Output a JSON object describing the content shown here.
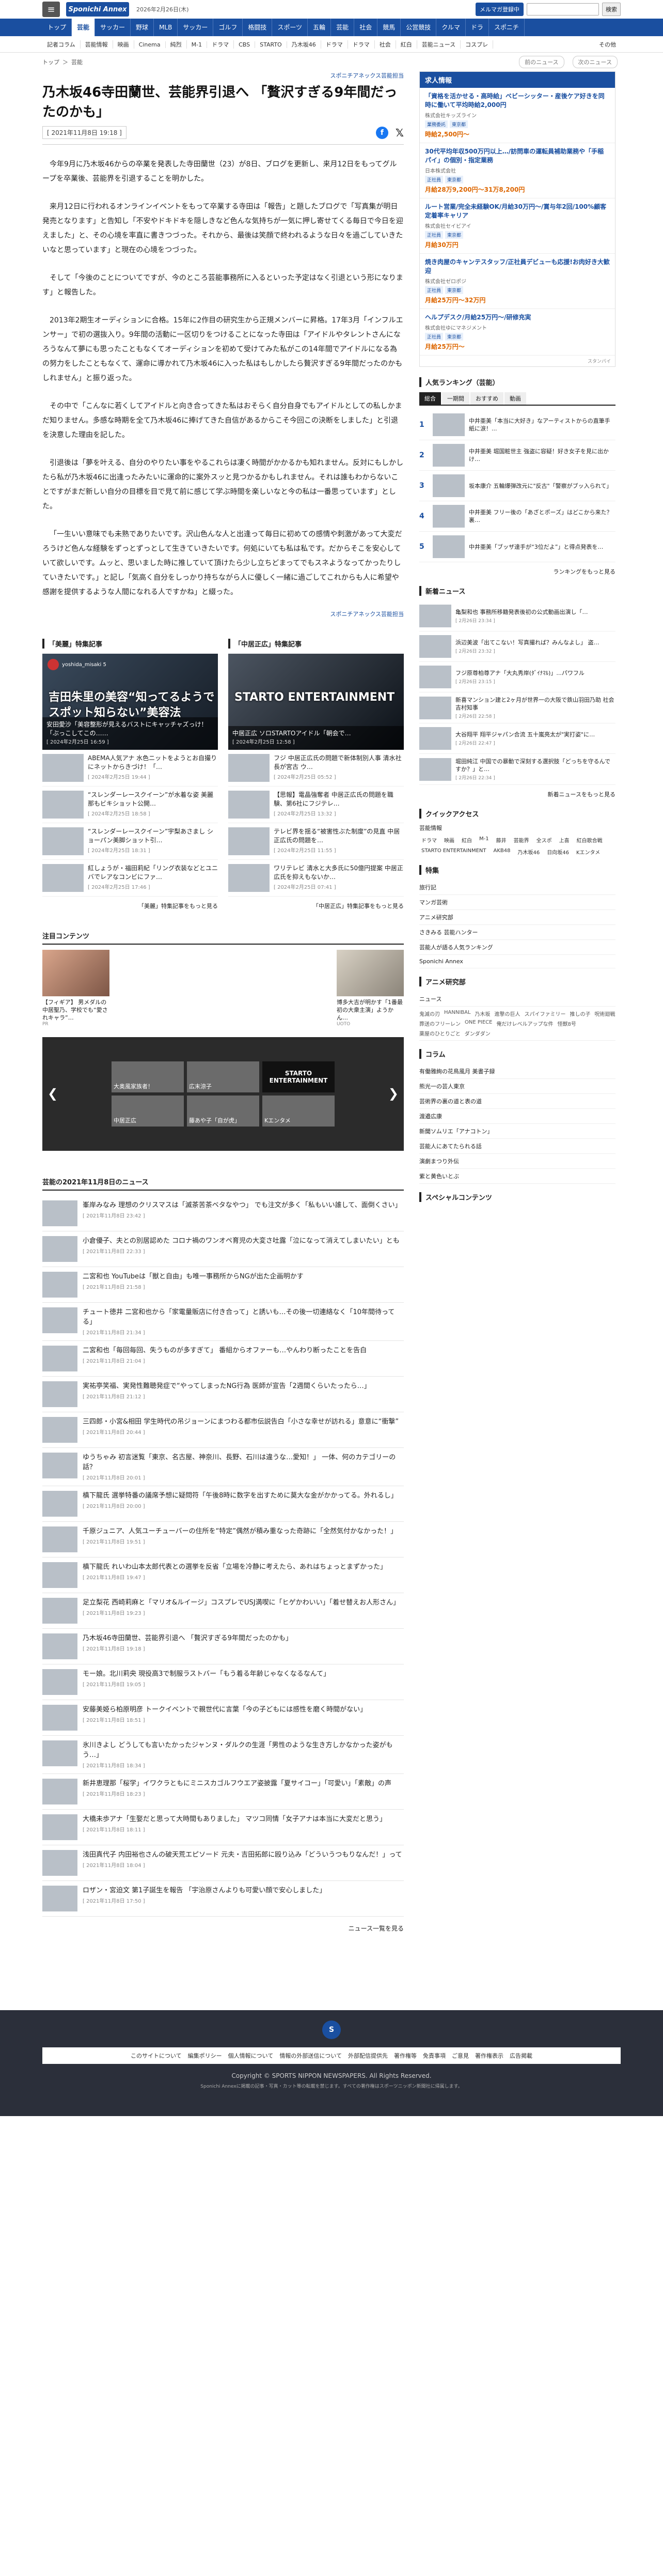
{
  "header": {
    "date": "2026年2月26日(木)",
    "subscribe": "メルマガ登録中",
    "search_btn": "検索",
    "logo": "Sponichi Annex"
  },
  "nav": [
    "トップ",
    "芸能",
    "サッカー",
    "野球",
    "MLB",
    "サッカー",
    "ゴルフ",
    "格闘技",
    "スポーツ",
    "五輪",
    "芸能",
    "社会",
    "競馬",
    "公営競技",
    "クルマ",
    "ドラ",
    "スポニチ"
  ],
  "subnav": [
    "記者コラム",
    "芸能情報",
    "映画",
    "Cinema",
    "純烈",
    "M-1",
    "ドラマ",
    "CBS",
    "STARTO",
    "乃木坂46",
    "ドラマ",
    "ドラマ",
    "社会",
    "紅白",
    "芸能ニュース",
    "コスプレ"
  ],
  "subnav_more": "その他",
  "crumbs": [
    "トップ",
    "＞",
    "芸能"
  ],
  "pager": {
    "prev": "前のニュース",
    "next": "次のニュース"
  },
  "article": {
    "credit": "スポニチアネックス芸能担当",
    "title": "乃木坂46寺田蘭世、芸能界引退へ 「贅沢すぎる9年間だったのかも」",
    "date": "[ 2021年11月8日 19:18 ]",
    "paragraphs": [
      "今年9月に乃木坂46からの卒業を発表した寺田蘭世（23）が8日、ブログを更新し、来月12日をもってグループを卒業後、芸能界を引退することを明かした。",
      "来月12日に行われるオンラインイベントをもって卒業する寺田は「報告」と題したブログで「写真集が明日発売となります」と告知し「不安やドキドキを隠しきなど色んな気持ちが一気に押し寄せてくる毎日で今日を迎えました」と、その心境を率直に書きつづった。それから、最後は笑顔で終われるような日々を過ごしていきたいなと思っています」と現在の心境をつづった。",
      "そして「今後のことについてですが、今のところ芸能事務所に入るといった予定はなく引退という形になります」と報告した。",
      "2013年2期生オーディションに合格。15年に2作目の研究生から正規メンバーに昇格。17年3月「インフルエンサー」で初の選抜入り。9年間の活動に一区切りをつけることになった寺田は「アイドルやタレントさんになろうなんて夢にも思ったこともなくてオーディションを初めて受けてみた私がこの14年間でアイドルになる為の努力をしたこともなくて、運命に導かれて乃木坂46に入った私はもしかしたら贅沢すぎる9年間だったのかもしれません」と振り返った。",
      "その中で「こんなに若くしてアイドルと向き合ってきた私はおそらく自分自身でもアイドルとしての私しかまだ知りません。多感な時期を全て乃木坂46に捧げてきた自信があるからこそ今回この決断をしました」と引退を決意した理由を記した。",
      "引退後は「夢を叶える、自分のやりたい事をやるこれらは凄く時間がかかるかも知れません。反対にもしかしたら私が乃木坂46に出逢ったみたいに運命的に案外スッと見つかるかもしれません。それは誰もわからないことですがまだ新しい自分の目標を目で見て前に感じて学ぶ時間を楽しいなと今の私は一番思っています」とした。",
      "「一生いい意味でも未熟でありたいです。沢山色んな人と出逢って毎日に初めての感情や刺激があって大変だろうけど色んな経験をずっとずっとして生きていきたいです。何処にいても私は私です。だからそこを安心していて欲しいです。ムッと、思いました時に推していて頂けたら少し立ちどまってでもスネようなってかったりしていきたいです。」と記し「気高く自分をしっかり持ちながら人に優しく一緒に過ごしてこれからも人に希望や感謝を提供するような人間になれる人ですかね」と綴った。"
    ],
    "credit2": "スポニチアネックス芸能担当"
  },
  "features": [
    {
      "head": "「美麗」特集記事",
      "channel": "yoshida_misaki 5",
      "hero": "吉田朱里の美容“知ってるようでスポット知らない”美容法",
      "cap": "安田愛沙「美容整形が見えるバストにキャッチャズっけ！「ぶっこしてこの……",
      "capdate": "[ 2024年2月25日 16:59 ]",
      "items": [
        {
          "t": "ABEMA人気アナ 水色ニットをようとお自撮りにネットからきづけ！「…",
          "d": "[ 2024年2月25日 19:44 ]"
        },
        {
          "t": "“スレンダーレースクイーン”が水着な姿 美麗那もビキショット公開…",
          "d": "[ 2024年2月25日 18:58 ]"
        },
        {
          "t": "“スレンダーレースクイーン”宇梨あさまし ショーパン美脚ショット引…",
          "d": "[ 2024年2月25日 18:31 ]"
        },
        {
          "t": "紅しょうが・福田莉紀「リング衣装などとユニバでレアなコンビにファ…",
          "d": "[ 2024年2月25日 17:46 ]"
        }
      ],
      "more": "「美麗」特集記事をもっと見る"
    },
    {
      "head": "「中居正広」特集記事",
      "channel": "",
      "hero": "STARTO ENTERTAINMENT",
      "cap": "中居正広 ソロSTARTOアイドル「朝会で…",
      "capdate": "[ 2024年2月25日 12:58 ]",
      "items": [
        {
          "t": "フジ 中居正広氏の問題で新体制別人事 清水社長が宮古 ウ…",
          "d": "[ 2024年2月25日 05:52 ]"
        },
        {
          "t": "【思報】電晶強奪者 中居正広氏の問題を職験、第6社にフジテレ…",
          "d": "[ 2024年2月25日 13:32 ]"
        },
        {
          "t": "テレビ界を揺る“被害性ぶた制度”の見直 中居正広氏の問題を…",
          "d": "[ 2024年2月25日 11:55 ]"
        },
        {
          "t": "ワリテレビ 清水と大多氏に50億円提案 中居正広氏を抑えもないか…",
          "d": "[ 2024年2月25日 07:41 ]"
        }
      ],
      "more": "「中居正広」特集記事をもっと見る"
    }
  ],
  "chu": {
    "head": "注目コンテンツ",
    "items": [
      {
        "t": "【フィギア】 男メダルの中居聖乃、学校でも“愛されキャラ”…",
        "src": "PR"
      },
      {
        "t": "博多大吉が明かす「1番最初の大衆主演」ようかん…",
        "src": "UOTO"
      }
    ]
  },
  "carousel": {
    "tiles": [
      "大奥風家族者！",
      "広末涼子",
      "STARTO ENTERTAINMENT",
      "中居正広",
      "藤あや子「自が虎」",
      "Kエンタメ"
    ]
  },
  "newslist": {
    "head": "芸能の2021年11月8日のニュース",
    "items": [
      {
        "t": "峯岸みなみ 理想のクリスマスは「滅茶苦茶ベタなやつ」 でも注文が多く「私もいい誰して、面倒くさい」",
        "d": "[ 2021年11月8日 23:42 ]"
      },
      {
        "t": "小倉優子、夫との別居認めた コロナ禍のワンオペ育児の大変さ吐露「泣になって消えてしまいたい」とも",
        "d": "[ 2021年11月8日 22:33 ]"
      },
      {
        "t": "二宮和也 YouTubeは「獣と自由」も唯一事務所からNGが出た企画明かす",
        "d": "[ 2021年11月8日 21:58 ]"
      },
      {
        "t": "チュート徳井 二宮和也から「家電量販店に付き合って」と誘いも…その後一切連絡なく「10年間待ってる」",
        "d": "[ 2021年11月8日 21:34 ]"
      },
      {
        "t": "二宮和也「毎回毎回、失うものが多すぎて」 番組からオファーも…やんわり断ったことを告白",
        "d": "[ 2021年11月8日 21:04 ]"
      },
      {
        "t": "実祐亭笑福、実発性難聴発症で“やってしまったNG行為 医師が宣告「2週間くらいたったら…」",
        "d": "[ 2021年11月8日 21:12 ]"
      },
      {
        "t": "三四郎・小宮&相田 学生時代の吊ジョーンにまつわる都市伝説告白「小さな幸せが訪れる」意意に“衝撃”",
        "d": "[ 2021年11月8日 20:44 ]"
      },
      {
        "t": "ゆうちゃみ 初言迷覧「東京、名古屋、神奈川、長野、石川は違うな…愛知！」 一体、何のカテゴリーの話？",
        "d": "[ 2021年11月8日 20:01 ]"
      },
      {
        "t": "槙下龍氏 選挙特番の議席予想に疑問符「午後8時に数字を出すために莫大な金がかかってる。外れるし」",
        "d": "[ 2021年11月8日 20:00 ]"
      },
      {
        "t": "千原ジュニア、人気ユーチューバーの住所を“特定”偶然が積み重なった奇跡に「全然気付かなかった！」",
        "d": "[ 2021年11月8日 19:51 ]"
      },
      {
        "t": "槙下龍氏 れいわ山本太郎代表との選挙を反省「立場を冷静に考えたら、あれはちょっとまずかった」",
        "d": "[ 2021年11月8日 19:47 ]"
      },
      {
        "t": "足立梨花 西崎莉麻と「マリオ&ルイージ」コスプレでUSJ満喫に「ヒゲかわいい」「着せ替えお人形さん」",
        "d": "[ 2021年11月8日 19:23 ]"
      },
      {
        "t": "乃木坂46寺田蘭世、芸能界引退へ 「贅沢すぎる9年間だったのかも」",
        "d": "[ 2021年11月8日 19:18 ]"
      },
      {
        "t": "モー娘。北川莉央 現役高3で制服ラストバー「もう着る年齢じゃなくなるなんて」",
        "d": "[ 2021年11月8日 19:05 ]"
      },
      {
        "t": "安藤美姫ら柏原明彦 トークイベントで親世代に言葉「今の子どもには感性を磨く時間がない」",
        "d": "[ 2021年11月8日 18:51 ]"
      },
      {
        "t": "氷川きよし どうしても言いたかったジャンヌ・ダルクの生涯「男性のような生き方しかなかった姿がもう…」",
        "d": "[ 2021年11月8日 18:34 ]"
      },
      {
        "t": "新井恵理那「桜学」イワクラともにミニスカゴルフウエア姿披露「夏サイコー」「可愛い」「素敵」の声",
        "d": "[ 2021年11月8日 18:23 ]"
      },
      {
        "t": "大橋未歩アナ「生娶だと思って大時間もありました」 マツコ同情「女子アナは本当に大変だと思う」",
        "d": "[ 2021年11月8日 18:11 ]"
      },
      {
        "t": "浅田真代子 内田裕也さんの破天荒エピソード 元夫・吉田拓郎に殴り込み「どういうつもりなんだ！」って",
        "d": "[ 2021年11月8日 18:04 ]"
      },
      {
        "t": "ロザン・宮迫文 第1子誕生を報告 「宇治原さんよりも可愛い顔で安心しました」",
        "d": "[ 2021年11月8日 17:50 ]"
      }
    ],
    "more": "ニュース一覧を見る"
  },
  "side": {
    "jobs_head": "求人情報",
    "jobs": [
      {
        "t": "「資格を活かせる・高時給」ベビーシッター・産後ケア好きを同時に働いて平均時給2,000円",
        "c": "株式会社キッズライン",
        "tags": [
          "業務委託",
          "東京都"
        ],
        "p": "時給2,500円～"
      },
      {
        "t": "30代平均年収500万円以上…/訪問車の運転員補助業務や「手稲パイ」の個別・指定業務",
        "c": "日本株式会社",
        "tags": [
          "正社員",
          "東京都"
        ],
        "p": "月給28万9,200円～31万8,200円"
      },
      {
        "t": "ルート営業/完全未経験OK/月給30万円～/賞与年2回/100%顧客定着率キャリア",
        "c": "株式会社セイビアイ",
        "tags": [
          "正社員",
          "東京都"
        ],
        "p": "月給30万円"
      },
      {
        "t": "焼き肉屋のキャンテスタッフ/正社員デビューも応援!お肉好き大歓迎",
        "c": "株式会社ゼロポジ",
        "tags": [
          "正社員",
          "東京都"
        ],
        "p": "月給25万円～32万円"
      },
      {
        "t": "ヘルプデスク/月給25万円～/研修充実",
        "c": "株式会社ゆにマネジメント",
        "tags": [
          "正社員",
          "東京都"
        ],
        "p": "月給25万円～"
      }
    ],
    "jobs_prov": "スタンバイ",
    "rank_head": "人気ランキング（芸能）",
    "rank_tabs": [
      "総合",
      "一期間",
      "おすすめ",
      "動画"
    ],
    "rank": [
      {
        "n": "1",
        "t": "中井亜美「本当に大好き」なアーティストからの直筆手紙に涙！..."
      },
      {
        "n": "2",
        "t": "中井亜美 堀国粧世主 強盗に容疑！好き女子を見に出かけ…"
      },
      {
        "n": "3",
        "t": "坂本康介 五輪爆弾改元に\"反古\"「警察がブッ入られて」"
      },
      {
        "n": "4",
        "t": "中井亜美 フリー後の「あざとポーズ」はどこから来た？裏…"
      },
      {
        "n": "5",
        "t": "中井亜美「ブッザ達手が“3位だよ”」と得点発表を…"
      }
    ],
    "rank_more": "ランキングをもっと見る",
    "snews_head": "新着ニュース",
    "snews": [
      {
        "t": "亀梨和也 事務所移籍発表後初の公式動画出演し「…",
        "d": "[ 2月26日 23:34 ]"
      },
      {
        "t": "浜辺美波「出てこない！写真撮れば？みんなよし」 盗…",
        "d": "[ 2月26日 23:32 ]"
      },
      {
        "t": "フジ原尊柏尊アナ「大丸秀岸(ﾀﾞｲﾅﾏﾙ)」...パワフル",
        "d": "[ 2月26日 23:15 ]"
      },
      {
        "t": "新喜マンション建と2ヶ月が世界一の大阪で鉄山羽田乃助 社会 吉村知事",
        "d": "[ 2月26日 22:58 ]"
      },
      {
        "t": "大谷翔平 翔平ジャパン合流 五十嵐亮太が\"実打姿\"に…",
        "d": "[ 2月26日 22:47 ]"
      },
      {
        "t": "堀田純江 中国での暴動で深刻する選択肢「どっちを守るんですか？」と…",
        "d": "[ 2月26日 22:34 ]"
      }
    ],
    "snews_more": "新着ニュースをもっと見る",
    "qc_head": "クイックアクセス",
    "qc_sub": "芸能情報",
    "qc": [
      "ドラマ",
      "映画",
      "紅白",
      "M-1",
      "藤井",
      "芸能界",
      "全スポ",
      "上喜",
      "紅白歌合戦",
      "STARTO ENTERTAINMENT",
      "AKB48",
      "乃木坂46",
      "日向坂46",
      "Kエンタメ"
    ],
    "sp_head": "特集",
    "sp": [
      "旅行記",
      "マンガ芸術",
      "アニメ研究部",
      "さきみる 芸能ハンター",
      "芸能人が語る人気ランキング",
      "Sponichi Annex"
    ],
    "anime_head": "アニメ研究部",
    "anime_sub": "ニュース",
    "anime": [
      "鬼滅の刃",
      "HANNIBAL",
      "乃木坂",
      "進撃の巨人",
      "スパイファミリー",
      "推しの子",
      "呪術廻戦",
      "葬送のフリーレン",
      "ONE PIECE",
      "俺だけレベルアップな件",
      "怪獣8号",
      "薬屋のひとりごと",
      "ダンダダン"
    ],
    "col_head": "コラム",
    "col": [
      "有働雅絢の花鳥風月 美書子録",
      "熊光一の芸人東京",
      "芸術界の裏の道と表の道",
      "渡邉広康",
      "新聞ソムリエ「アナコトン」",
      "芸能人にあてたられる話",
      "演劇まつり外伝",
      "紫と黄色いとぶ"
    ],
    "spc_head": "スペシャルコンテンツ"
  },
  "footer": {
    "logo": "S",
    "links": [
      "このサイトについて",
      "編集ポリシー",
      "個人情報について",
      "情報の外部送信について",
      "外部配信提供先",
      "著作権等",
      "免責事項",
      "ご意見",
      "著作権表示",
      "広告掲載"
    ],
    "copy": "Copyright © SPORTS NIPPON NEWSPAPERS. All Rights Reserved.",
    "note": "Sponichi Annexに掲載の記事・写真・カット等の転載を禁じます。すべての著作権はスポーツニッポン新聞社に帰属します。"
  },
  "colors": {
    "brand": "#1a4fa0",
    "accent": "#d60"
  }
}
